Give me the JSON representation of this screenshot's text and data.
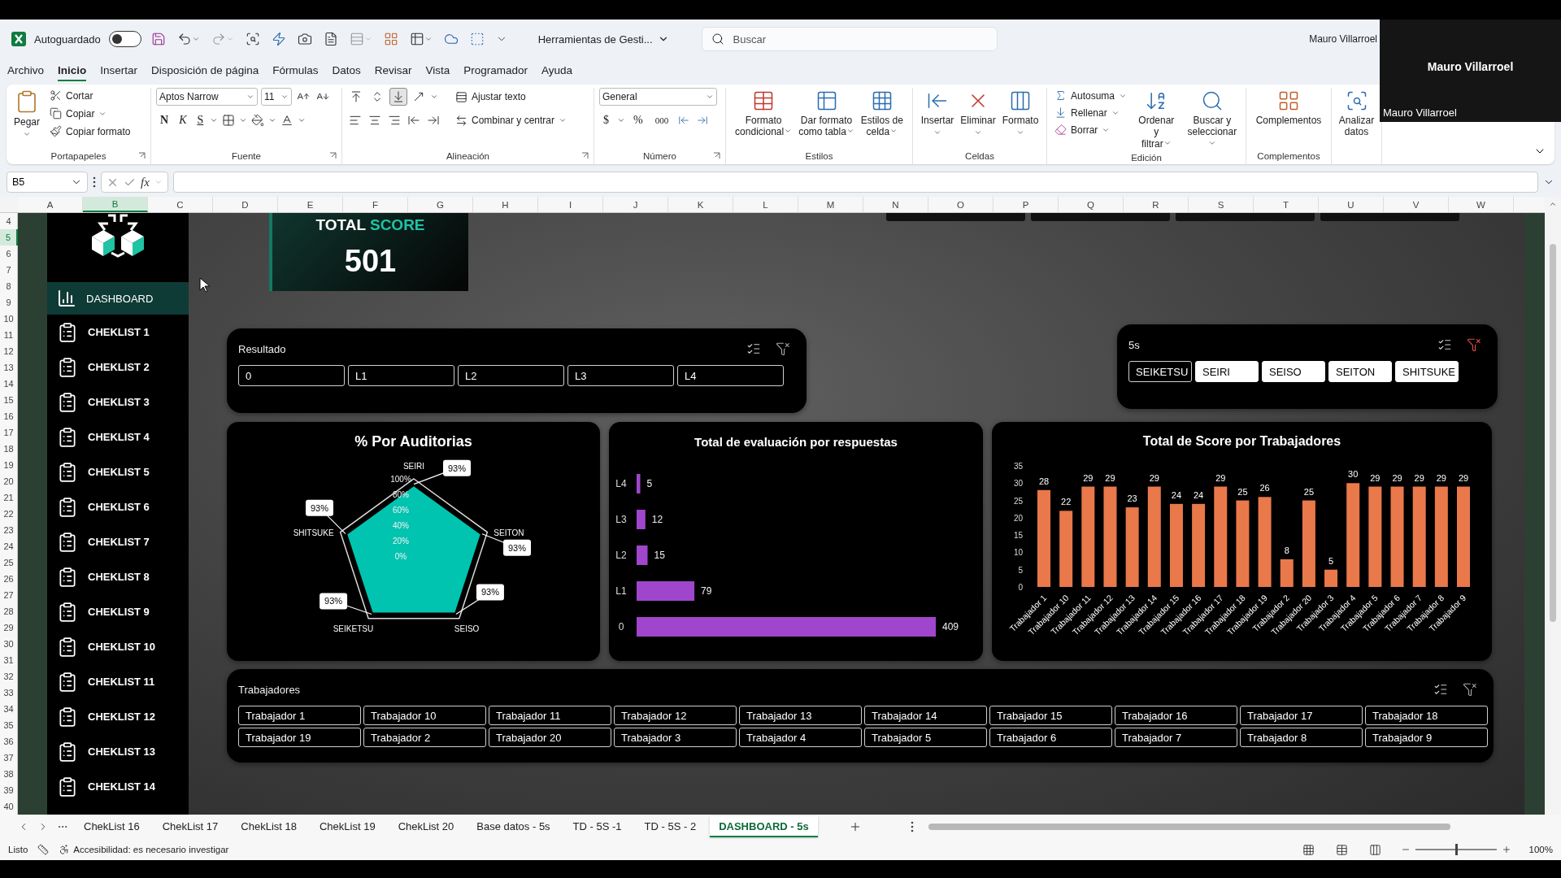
{
  "title_bar": {
    "autosave_label": "Autoguardado",
    "autosave_on": false,
    "file_name": "Herramientas de Gesti...",
    "search_placeholder": "Buscar",
    "user": "Mauro Villarroel"
  },
  "video_overlay": {
    "name": "Mauro Villarroel",
    "caption": "Mauro Villarroel"
  },
  "menu_tabs": [
    {
      "label": "Archivo",
      "selected": false
    },
    {
      "label": "Inicio",
      "selected": true
    },
    {
      "label": "Insertar",
      "selected": false
    },
    {
      "label": "Disposición de página",
      "selected": false
    },
    {
      "label": "Fórmulas",
      "selected": false
    },
    {
      "label": "Datos",
      "selected": false
    },
    {
      "label": "Revisar",
      "selected": false
    },
    {
      "label": "Vista",
      "selected": false
    },
    {
      "label": "Programador",
      "selected": false
    },
    {
      "label": "Ayuda",
      "selected": false
    }
  ],
  "ribbon": {
    "clipboard": {
      "paste": "Pegar",
      "items": [
        "Cortar",
        "Copiar",
        "Copiar formato"
      ],
      "label": "Portapapeles"
    },
    "font": {
      "font": "Aptos Narrow",
      "size": "11",
      "bold": "N",
      "italic": "K",
      "underline": "S",
      "label": "Fuente"
    },
    "alignment": {
      "vertical": [
        {
          "selected": false
        },
        {
          "selected": false
        },
        {
          "selected": true
        }
      ],
      "wrap": "Ajustar texto",
      "merge": "Combinar y centrar",
      "label": "Alineación"
    },
    "number": {
      "format": "General",
      "currency": "$",
      "percent": "%",
      "thousands": "000",
      "label": "Número"
    },
    "styles": {
      "items": [
        "Formato\ncondicional",
        "Dar formato\ncomo tabla",
        "Estilos de\ncelda"
      ],
      "label": "Estilos"
    },
    "cells": {
      "items": [
        "Insertar",
        "Eliminar",
        "Formato"
      ],
      "label": "Celdas"
    },
    "editing": {
      "small": [
        "Autosuma",
        "Rellenar",
        "Borrar"
      ],
      "large": [
        "Ordenar y\nfiltrar",
        "Buscar y\nseleccionar"
      ],
      "label": "Edición"
    },
    "addins": {
      "items": [
        "Complementos"
      ],
      "label": "Complementos"
    },
    "analyze": {
      "items": [
        "Analizar\ndatos"
      ]
    }
  },
  "formula_bar": {
    "name_box": "B5",
    "fx": "fx"
  },
  "columns": [
    {
      "label": "A",
      "selected": false
    },
    {
      "label": "B",
      "selected": true
    },
    {
      "label": "C",
      "selected": false
    },
    {
      "label": "D",
      "selected": false
    },
    {
      "label": "E",
      "selected": false
    },
    {
      "label": "F",
      "selected": false
    },
    {
      "label": "G",
      "selected": false
    },
    {
      "label": "H",
      "selected": false
    },
    {
      "label": "I",
      "selected": false
    },
    {
      "label": "J",
      "selected": false
    },
    {
      "label": "K",
      "selected": false
    },
    {
      "label": "L",
      "selected": false
    },
    {
      "label": "M",
      "selected": false
    },
    {
      "label": "N",
      "selected": false
    },
    {
      "label": "O",
      "selected": false
    },
    {
      "label": "P",
      "selected": false
    },
    {
      "label": "Q",
      "selected": false
    },
    {
      "label": "R",
      "selected": false
    },
    {
      "label": "S",
      "selected": false
    },
    {
      "label": "T",
      "selected": false
    },
    {
      "label": "U",
      "selected": false
    },
    {
      "label": "V",
      "selected": false
    },
    {
      "label": "W",
      "selected": false
    }
  ],
  "rows": [
    {
      "label": "4",
      "selected": false
    },
    {
      "label": "5",
      "selected": true
    },
    {
      "label": "6",
      "selected": false
    },
    {
      "label": "7",
      "selected": false
    },
    {
      "label": "8",
      "selected": false
    },
    {
      "label": "9",
      "selected": false
    },
    {
      "label": "10",
      "selected": false
    },
    {
      "label": "11",
      "selected": false
    },
    {
      "label": "12",
      "selected": false
    },
    {
      "label": "13",
      "selected": false
    },
    {
      "label": "14",
      "selected": false
    },
    {
      "label": "15",
      "selected": false
    },
    {
      "label": "16",
      "selected": false
    },
    {
      "label": "17",
      "selected": false
    },
    {
      "label": "18",
      "selected": false
    },
    {
      "label": "19",
      "selected": false
    },
    {
      "label": "20",
      "selected": false
    },
    {
      "label": "21",
      "selected": false
    },
    {
      "label": "22",
      "selected": false
    },
    {
      "label": "23",
      "selected": false
    },
    {
      "label": "24",
      "selected": false
    },
    {
      "label": "25",
      "selected": false
    },
    {
      "label": "26",
      "selected": false
    },
    {
      "label": "27",
      "selected": false
    },
    {
      "label": "28",
      "selected": false
    },
    {
      "label": "29",
      "selected": false
    },
    {
      "label": "30",
      "selected": false
    },
    {
      "label": "31",
      "selected": false
    },
    {
      "label": "32",
      "selected": false
    },
    {
      "label": "33",
      "selected": false
    },
    {
      "label": "34",
      "selected": false
    },
    {
      "label": "35",
      "selected": false
    },
    {
      "label": "36",
      "selected": false
    },
    {
      "label": "37",
      "selected": false
    },
    {
      "label": "38",
      "selected": false
    },
    {
      "label": "39",
      "selected": false
    },
    {
      "label": "40",
      "selected": false
    }
  ],
  "sidebar": {
    "items": [
      {
        "label": "DASHBOARD",
        "kind": "dashboard",
        "selected": true
      },
      {
        "label": "CHEKLIST 1",
        "kind": "checklist",
        "selected": false
      },
      {
        "label": "CHEKLIST 2",
        "kind": "checklist",
        "selected": false
      },
      {
        "label": "CHEKLIST 3",
        "kind": "checklist",
        "selected": false
      },
      {
        "label": "CHEKLIST 4",
        "kind": "checklist",
        "selected": false
      },
      {
        "label": "CHEKLIST 5",
        "kind": "checklist",
        "selected": false
      },
      {
        "label": "CHEKLIST 6",
        "kind": "checklist",
        "selected": false
      },
      {
        "label": "CHEKLIST 7",
        "kind": "checklist",
        "selected": false
      },
      {
        "label": "CHEKLIST 8",
        "kind": "checklist",
        "selected": false
      },
      {
        "label": "CHEKLIST 9",
        "kind": "checklist",
        "selected": false
      },
      {
        "label": "CHEKLIST 10",
        "kind": "checklist",
        "selected": false
      },
      {
        "label": "CHEKLIST 11",
        "kind": "checklist",
        "selected": false
      },
      {
        "label": "CHEKLIST 12",
        "kind": "checklist",
        "selected": false
      },
      {
        "label": "CHEKLIST 13",
        "kind": "checklist",
        "selected": false
      },
      {
        "label": "CHEKLIST 14",
        "kind": "checklist",
        "selected": false
      }
    ]
  },
  "total_score": {
    "title_main": "TOTAL",
    "title_accent": "SCORE",
    "value": "501"
  },
  "slicers": {
    "resultado": {
      "title": "Resultado",
      "filter_active": false,
      "items": [
        {
          "label": "0",
          "selected": false
        },
        {
          "label": "L1",
          "selected": false
        },
        {
          "label": "L2",
          "selected": false
        },
        {
          "label": "L3",
          "selected": false
        },
        {
          "label": "L4",
          "selected": false
        }
      ]
    },
    "five_s": {
      "title": "5s",
      "filter_active": true,
      "items": [
        {
          "label": "SEIKETSU",
          "selected": false
        },
        {
          "label": "SEIRI",
          "selected": true
        },
        {
          "label": "SEISO",
          "selected": true
        },
        {
          "label": "SEITON",
          "selected": true
        },
        {
          "label": "SHITSUKE",
          "selected": true
        }
      ]
    },
    "trabajadores": {
      "title": "Trabajadores",
      "filter_active": false,
      "items": [
        {
          "label": "Trabajador 1",
          "selected": false
        },
        {
          "label": "Trabajador 10",
          "selected": false
        },
        {
          "label": "Trabajador 11",
          "selected": false
        },
        {
          "label": "Trabajador 12",
          "selected": false
        },
        {
          "label": "Trabajador 13",
          "selected": false
        },
        {
          "label": "Trabajador 14",
          "selected": false
        },
        {
          "label": "Trabajador 15",
          "selected": false
        },
        {
          "label": "Trabajador 16",
          "selected": false
        },
        {
          "label": "Trabajador 17",
          "selected": false
        },
        {
          "label": "Trabajador 18",
          "selected": false
        },
        {
          "label": "Trabajador 19",
          "selected": false
        },
        {
          "label": "Trabajador 2",
          "selected": false
        },
        {
          "label": "Trabajador 20",
          "selected": false
        },
        {
          "label": "Trabajador 3",
          "selected": false
        },
        {
          "label": "Trabajador 4",
          "selected": false
        },
        {
          "label": "Trabajador 5",
          "selected": false
        },
        {
          "label": "Trabajador 6",
          "selected": false
        },
        {
          "label": "Trabajador 7",
          "selected": false
        },
        {
          "label": "Trabajador 8",
          "selected": false
        },
        {
          "label": "Trabajador 9",
          "selected": false
        }
      ]
    }
  },
  "radar_chart": {
    "title": "% Por Auditorias",
    "ticks": [
      "100%",
      "80%",
      "60%",
      "40%",
      "20%",
      "0%"
    ],
    "axes": [
      {
        "label": "SEIRI",
        "value_label": "93%"
      },
      {
        "label": "SHITSUKE",
        "value_label": "93%"
      },
      {
        "label": "SEITON",
        "value_label": "93%"
      },
      {
        "label": "SEIKETSU",
        "value_label": "93%"
      },
      {
        "label": "SEISO",
        "value_label": "93%"
      }
    ]
  },
  "charts": [
    {
      "chart_data": {
        "type": "bar",
        "orientation": "horizontal",
        "title": "Total de evaluación por respuestas",
        "categories": [
          "L4",
          "L3",
          "L2",
          "L1",
          "0"
        ],
        "series": [
          {
            "color": "#a046cc",
            "values": [
              5,
              12,
              15,
              79,
              409
            ]
          }
        ],
        "data_labels": true
      }
    },
    {
      "chart_data": {
        "type": "bar",
        "orientation": "vertical",
        "title": "Total de Score por Trabajadores",
        "categories": [
          "Trabajador 1",
          "Trabajador 10",
          "Trabajador 11",
          "Trabajador 12",
          "Trabajador 13",
          "Trabajador 14",
          "Trabajador 15",
          "Trabajador 16",
          "Trabajador 17",
          "Trabajador 18",
          "Trabajador 19",
          "Trabajador 2",
          "Trabajador 20",
          "Trabajador 3",
          "Trabajador 4",
          "Trabajador 5",
          "Trabajador 6",
          "Trabajador 7",
          "Trabajador 8",
          "Trabajador 9"
        ],
        "series": [
          {
            "color": "#e9784a",
            "values": [
              28,
              22,
              29,
              29,
              23,
              29,
              24,
              24,
              29,
              25,
              26,
              8,
              25,
              5,
              30,
              29,
              29,
              29,
              29,
              29
            ]
          }
        ],
        "ylim": [
          0,
          35
        ],
        "yticks": [
          0,
          5,
          10,
          15,
          20,
          25,
          30,
          35
        ],
        "data_labels": true
      }
    }
  ],
  "sheet_tabs": [
    {
      "label": "ChekList 16",
      "selected": false
    },
    {
      "label": "ChekList 17",
      "selected": false
    },
    {
      "label": "ChekList 18",
      "selected": false
    },
    {
      "label": "ChekList 19",
      "selected": false
    },
    {
      "label": "ChekList 20",
      "selected": false
    },
    {
      "label": "Base datos - 5s",
      "selected": false
    },
    {
      "label": "TD - 5S -1",
      "selected": false
    },
    {
      "label": "TD - 5S - 2",
      "selected": false
    },
    {
      "label": "DASHBOARD - 5s",
      "selected": true
    }
  ],
  "status_bar": {
    "ready": "Listo",
    "accessibility": "Accesibilidad: es necesario investigar",
    "zoom": "100%",
    "zoom_slider": {
      "level": 0.5
    }
  }
}
